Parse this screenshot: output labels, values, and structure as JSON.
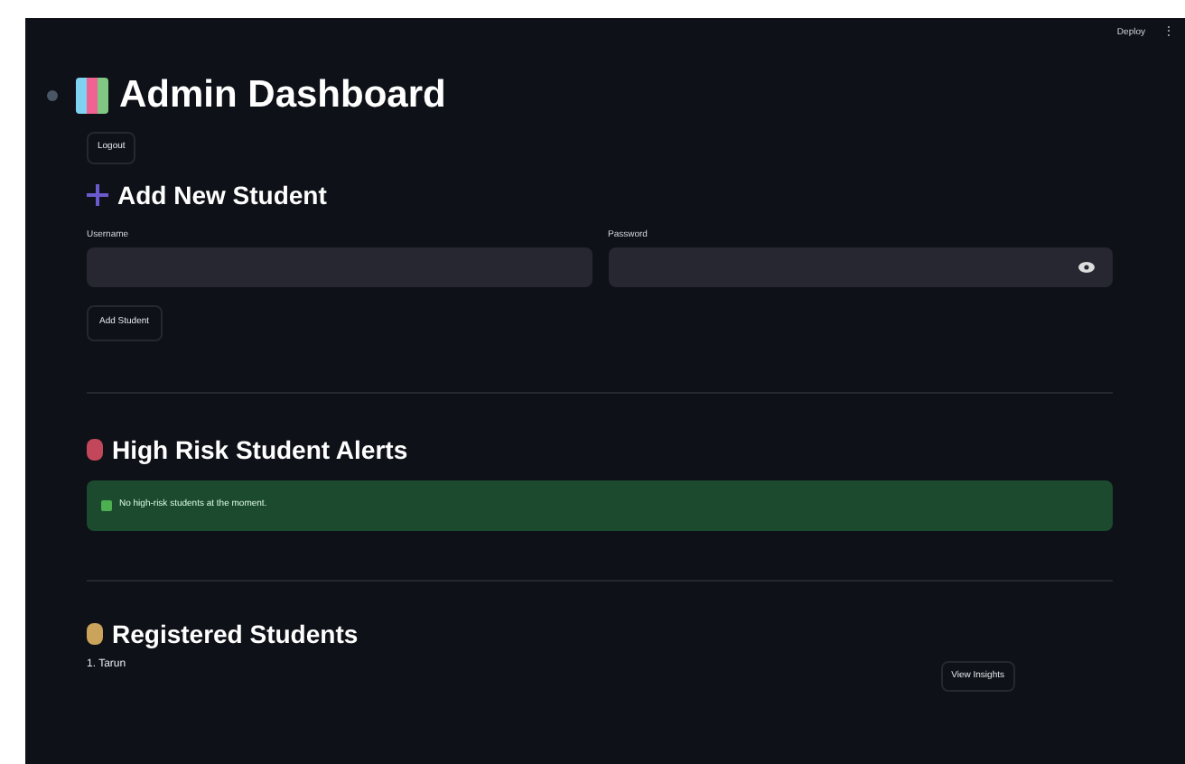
{
  "header": {
    "deploy": "Deploy",
    "menu": "⋮"
  },
  "title": "Admin Dashboard",
  "logout": "Logout",
  "add_student": {
    "heading": "Add New Student",
    "fields": [
      {
        "label": "Username",
        "kind": "text"
      },
      {
        "label": "Password",
        "kind": "password"
      }
    ],
    "button": "Add Student"
  },
  "alerts": {
    "heading": "High Risk Student Alerts",
    "message": "No high-risk students at the moment."
  },
  "registered": {
    "heading": "Registered Students",
    "students": [
      {
        "name": "1. Tarun",
        "button": "View Insights"
      }
    ]
  }
}
